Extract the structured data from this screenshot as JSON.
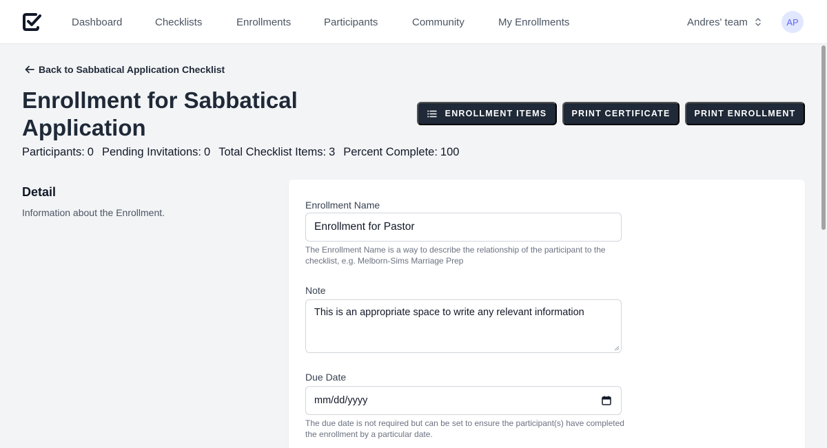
{
  "nav": {
    "logo_name": "checklist-logo",
    "links": [
      "Dashboard",
      "Checklists",
      "Enrollments",
      "Participants",
      "Community",
      "My Enrollments"
    ],
    "team": "Andres' team",
    "avatar_initials": "AP"
  },
  "header": {
    "back_label": "Back to Sabbatical Application Checklist",
    "title": "Enrollment for Sabbatical Application",
    "stats": [
      {
        "label": "Participants:",
        "value": "0"
      },
      {
        "label": "Pending Invitations:",
        "value": "0"
      },
      {
        "label": "Total Checklist Items:",
        "value": "3"
      },
      {
        "label": "Percent Complete:",
        "value": "100"
      }
    ],
    "buttons": {
      "enrollment_items": "ENROLLMENT ITEMS",
      "print_certificate": "PRINT CERTIFICATE",
      "print_enrollment": "PRINT ENROLLMENT"
    }
  },
  "detail": {
    "title": "Detail",
    "description": "Information about the Enrollment."
  },
  "form": {
    "enrollment_name": {
      "label": "Enrollment Name",
      "value": "Enrollment for Pastor",
      "help": "The Enrollment Name is a way to describe the relationship of the participant to the checklist, e.g. Melborn-Sims Marriage Prep"
    },
    "note": {
      "label": "Note",
      "value": "This is an appropriate space to write any relevant information"
    },
    "due_date": {
      "label": "Due Date",
      "placeholder": "mm/dd/yyyy",
      "help": "The due date is not required but can be set to ensure the participant(s) have completed the enrollment by a particular date."
    }
  },
  "colors": {
    "primary_button": "#1f2937",
    "page_background": "#f3f4f6",
    "avatar_bg": "#e0e7ff",
    "avatar_text": "#6366f1"
  }
}
